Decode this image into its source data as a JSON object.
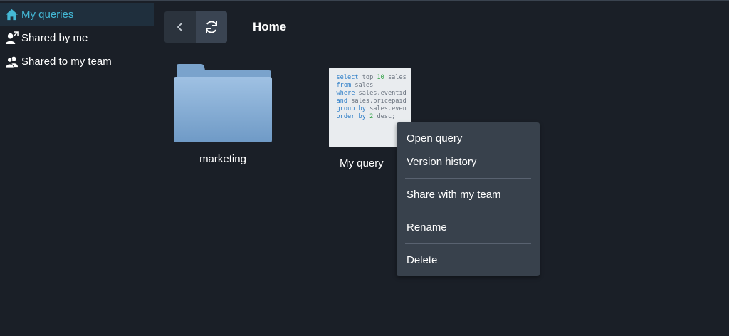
{
  "sidebar": {
    "items": [
      {
        "label": "My queries",
        "icon": "home-icon",
        "active": true
      },
      {
        "label": "Shared by me",
        "icon": "share-user-icon"
      },
      {
        "label": "Shared to my team",
        "icon": "team-icon"
      }
    ]
  },
  "header": {
    "title": "Home",
    "back_icon": "chevron-left-icon",
    "refresh_icon": "refresh-icon"
  },
  "items": [
    {
      "type": "folder",
      "name": "marketing",
      "icon": "folder-icon"
    },
    {
      "type": "query",
      "name": "My query",
      "preview_lines": [
        "select top 10 sales",
        "from sales",
        "where sales.eventid",
        "and sales.pricepaid",
        "group by sales.even",
        "order by 2 desc;"
      ]
    }
  ],
  "context_menu": {
    "items": [
      "Open query",
      "Version history",
      "Share with my team",
      "Rename",
      "Delete"
    ]
  },
  "colors": {
    "background": "#1a1f27",
    "accent": "#44b9d6",
    "menu_background": "#38414c",
    "folder": "#8eb3d8"
  }
}
